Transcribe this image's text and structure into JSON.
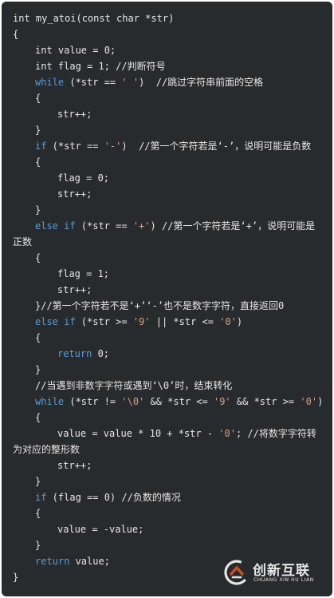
{
  "code": {
    "lines": [
      {
        "indent": 0,
        "tokens": [
          {
            "t": "pl",
            "v": "int my_atoi(const char *str)"
          }
        ]
      },
      {
        "indent": 0,
        "tokens": [
          {
            "t": "pl",
            "v": "{"
          }
        ]
      },
      {
        "indent": 1,
        "tokens": [
          {
            "t": "pl",
            "v": "int value = 0;"
          }
        ]
      },
      {
        "indent": 1,
        "tokens": [
          {
            "t": "pl",
            "v": "int flag = 1; //判断符号"
          }
        ]
      },
      {
        "indent": 1,
        "tokens": [
          {
            "t": "kw",
            "v": "while"
          },
          {
            "t": "pl",
            "v": " (*str == "
          },
          {
            "t": "str",
            "v": "' '"
          },
          {
            "t": "pl",
            "v": ")  //跳过字符串前面的空格"
          }
        ]
      },
      {
        "indent": 1,
        "tokens": [
          {
            "t": "pl",
            "v": "{"
          }
        ]
      },
      {
        "indent": 2,
        "tokens": [
          {
            "t": "pl",
            "v": "str++;"
          }
        ]
      },
      {
        "indent": 1,
        "tokens": [
          {
            "t": "pl",
            "v": "}"
          }
        ]
      },
      {
        "indent": 1,
        "tokens": [
          {
            "t": "kw",
            "v": "if"
          },
          {
            "t": "pl",
            "v": " (*str == "
          },
          {
            "t": "str",
            "v": "'-'"
          },
          {
            "t": "pl",
            "v": ")  //第一个字符若是‘-’，说明可能是负数"
          }
        ]
      },
      {
        "indent": 1,
        "tokens": [
          {
            "t": "pl",
            "v": "{"
          }
        ]
      },
      {
        "indent": 2,
        "tokens": [
          {
            "t": "pl",
            "v": "flag = 0;"
          }
        ]
      },
      {
        "indent": 2,
        "tokens": [
          {
            "t": "pl",
            "v": "str++;"
          }
        ]
      },
      {
        "indent": 1,
        "tokens": [
          {
            "t": "pl",
            "v": "}"
          }
        ]
      },
      {
        "indent": 1,
        "tokens": [
          {
            "t": "kw",
            "v": "else if"
          },
          {
            "t": "pl",
            "v": " (*str == "
          },
          {
            "t": "str",
            "v": "'+'"
          },
          {
            "t": "pl",
            "v": ") //第一个字符若是‘+’，说明可能是"
          }
        ]
      },
      {
        "indent": 0,
        "tokens": [
          {
            "t": "pl",
            "v": "正数"
          }
        ]
      },
      {
        "indent": 1,
        "tokens": [
          {
            "t": "pl",
            "v": "{"
          }
        ]
      },
      {
        "indent": 2,
        "tokens": [
          {
            "t": "pl",
            "v": "flag = 1;"
          }
        ]
      },
      {
        "indent": 2,
        "tokens": [
          {
            "t": "pl",
            "v": "str++;"
          }
        ]
      },
      {
        "indent": 1,
        "tokens": [
          {
            "t": "pl",
            "v": "}//第一个字符若不是‘+’‘-’也不是数字字符，直接返回0"
          }
        ]
      },
      {
        "indent": 1,
        "tokens": [
          {
            "t": "kw",
            "v": "else if"
          },
          {
            "t": "pl",
            "v": " (*str >= "
          },
          {
            "t": "str",
            "v": "'9'"
          },
          {
            "t": "pl",
            "v": " || *str <= "
          },
          {
            "t": "str",
            "v": "'0'"
          },
          {
            "t": "pl",
            "v": ")"
          }
        ]
      },
      {
        "indent": 1,
        "tokens": [
          {
            "t": "pl",
            "v": "{"
          }
        ]
      },
      {
        "indent": 2,
        "tokens": [
          {
            "t": "kw",
            "v": "return"
          },
          {
            "t": "pl",
            "v": " 0;"
          }
        ]
      },
      {
        "indent": 1,
        "tokens": [
          {
            "t": "pl",
            "v": "}"
          }
        ]
      },
      {
        "indent": 1,
        "tokens": [
          {
            "t": "pl",
            "v": "//当遇到非数字字符或遇到‘\\0’时，结束转化"
          }
        ]
      },
      {
        "indent": 1,
        "tokens": [
          {
            "t": "kw",
            "v": "while"
          },
          {
            "t": "pl",
            "v": " (*str != "
          },
          {
            "t": "str",
            "v": "'\\0'"
          },
          {
            "t": "pl",
            "v": " && *str <= "
          },
          {
            "t": "str",
            "v": "'9'"
          },
          {
            "t": "pl",
            "v": " && *str >= "
          },
          {
            "t": "str",
            "v": "'0'"
          },
          {
            "t": "pl",
            "v": ")"
          }
        ]
      },
      {
        "indent": 1,
        "tokens": [
          {
            "t": "pl",
            "v": "{"
          }
        ]
      },
      {
        "indent": 2,
        "tokens": [
          {
            "t": "pl",
            "v": "value = value * 10 + *str - "
          },
          {
            "t": "str",
            "v": "'0'"
          },
          {
            "t": "pl",
            "v": "; //将数字字符转"
          }
        ]
      },
      {
        "indent": 0,
        "tokens": [
          {
            "t": "pl",
            "v": "为对应的整形数"
          }
        ]
      },
      {
        "indent": 2,
        "tokens": [
          {
            "t": "pl",
            "v": "str++;"
          }
        ]
      },
      {
        "indent": 1,
        "tokens": [
          {
            "t": "pl",
            "v": "}"
          }
        ]
      },
      {
        "indent": 1,
        "tokens": [
          {
            "t": "kw",
            "v": "if"
          },
          {
            "t": "pl",
            "v": " (flag == 0) //负数的情况"
          }
        ]
      },
      {
        "indent": 1,
        "tokens": [
          {
            "t": "pl",
            "v": "{"
          }
        ]
      },
      {
        "indent": 2,
        "tokens": [
          {
            "t": "pl",
            "v": "value = -value;"
          }
        ]
      },
      {
        "indent": 1,
        "tokens": [
          {
            "t": "pl",
            "v": "}"
          }
        ]
      },
      {
        "indent": 1,
        "tokens": [
          {
            "t": "kw",
            "v": "return"
          },
          {
            "t": "pl",
            "v": " value;"
          }
        ]
      },
      {
        "indent": 0,
        "tokens": [
          {
            "t": "pl",
            "v": "}"
          }
        ]
      }
    ]
  },
  "watermark": {
    "title": "创新互联",
    "subtitle": "CHUANG XIN HU LIAN",
    "logo_icon": "chuangxin-logo-icon"
  },
  "colors": {
    "background": "#282b2e",
    "keyword": "#569cd6",
    "string": "#d69d85",
    "text": "#e6e6e6"
  }
}
